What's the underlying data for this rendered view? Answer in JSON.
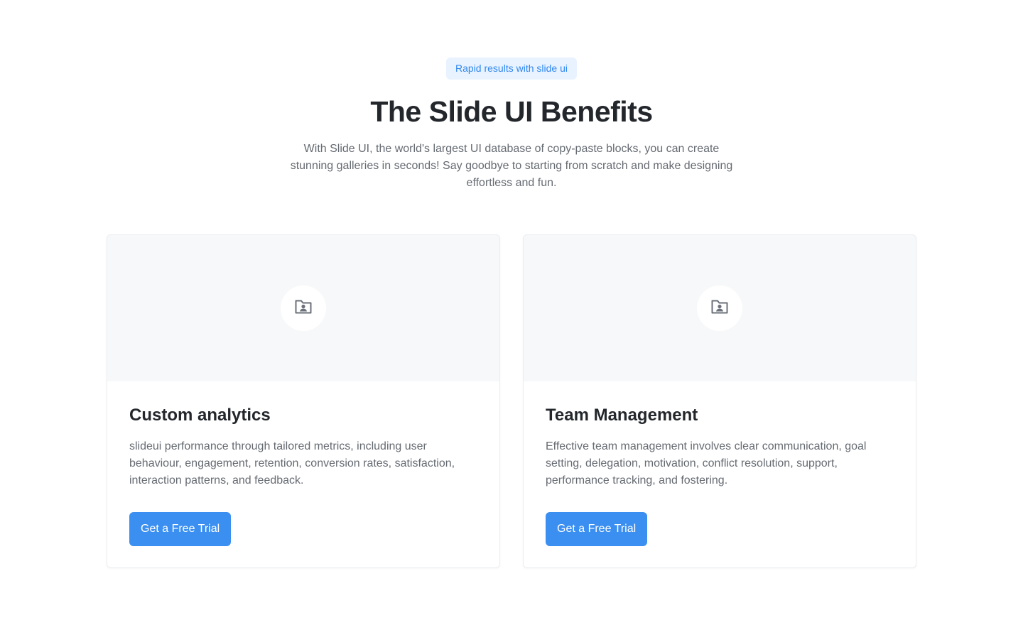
{
  "hero": {
    "badge": "Rapid results with slide ui",
    "title": "The Slide UI Benefits",
    "subtitle": "With Slide UI, the world's largest UI database of copy-paste blocks, you can create stunning galleries in seconds! Say goodbye to starting from scratch and make designing effortless and fun."
  },
  "cards": [
    {
      "icon": "folder-user-icon",
      "title": "Custom analytics",
      "description": "slideui performance through tailored metrics, including user behaviour, engagement, retention, conversion rates, satisfaction, interaction patterns, and feedback.",
      "cta": "Get a Free Trial"
    },
    {
      "icon": "folder-user-icon",
      "title": "Team Management",
      "description": "Effective team management involves clear communication, goal setting, delegation, motivation, conflict resolution, support, performance tracking, and fostering.",
      "cta": "Get a Free Trial"
    }
  ],
  "colors": {
    "accent": "#3b8ff0",
    "badge_bg": "#e8f3ff",
    "badge_text": "#2f86f0",
    "media_bg": "#f7f8f9",
    "body_text": "#666b72",
    "heading_text": "#23272c"
  }
}
